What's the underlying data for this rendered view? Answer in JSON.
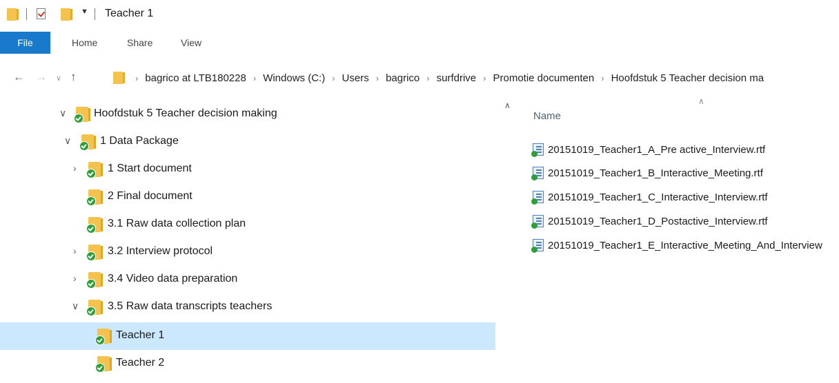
{
  "window": {
    "title": "Teacher 1"
  },
  "ribbon": {
    "tabs": [
      "File",
      "Home",
      "Share",
      "View"
    ]
  },
  "address": {
    "crumbs": [
      "bagrico at LTB180228",
      "Windows (C:)",
      "Users",
      "bagrico",
      "surfdrive",
      "Promotie documenten",
      "Hoofdstuk 5 Teacher decision ma"
    ]
  },
  "tree": {
    "items": [
      {
        "label": "Hoofdstuk 5 Teacher decision making",
        "expander": "expanded"
      },
      {
        "label": "1 Data Package",
        "expander": "expanded"
      },
      {
        "label": "1 Start document",
        "expander": "collapsed"
      },
      {
        "label": "2 Final document",
        "expander": "none"
      },
      {
        "label": "3.1 Raw data collection plan",
        "expander": "none"
      },
      {
        "label": "3.2 Interview protocol",
        "expander": "collapsed"
      },
      {
        "label": "3.4 Video data preparation",
        "expander": "collapsed"
      },
      {
        "label": "3.5 Raw data transcripts teachers",
        "expander": "expanded"
      },
      {
        "label": "Teacher 1",
        "expander": "none",
        "selected": true
      },
      {
        "label": "Teacher 2",
        "expander": "none"
      }
    ]
  },
  "filelist": {
    "column_header": "Name",
    "files": [
      "20151019_Teacher1_A_Pre active_Interview.rtf",
      "20151019_Teacher1_B_Interactive_Meeting.rtf",
      "20151019_Teacher1_C_Interactive_Interview.rtf",
      "20151019_Teacher1_D_Postactive_Interview.rtf",
      "20151019_Teacher1_E_Interactive_Meeting_And_Interview"
    ]
  },
  "colors": {
    "accent": "#1979ca",
    "selection": "#cce8ff",
    "folder": "#f3c24f",
    "sync_badge": "#2e9e39"
  }
}
